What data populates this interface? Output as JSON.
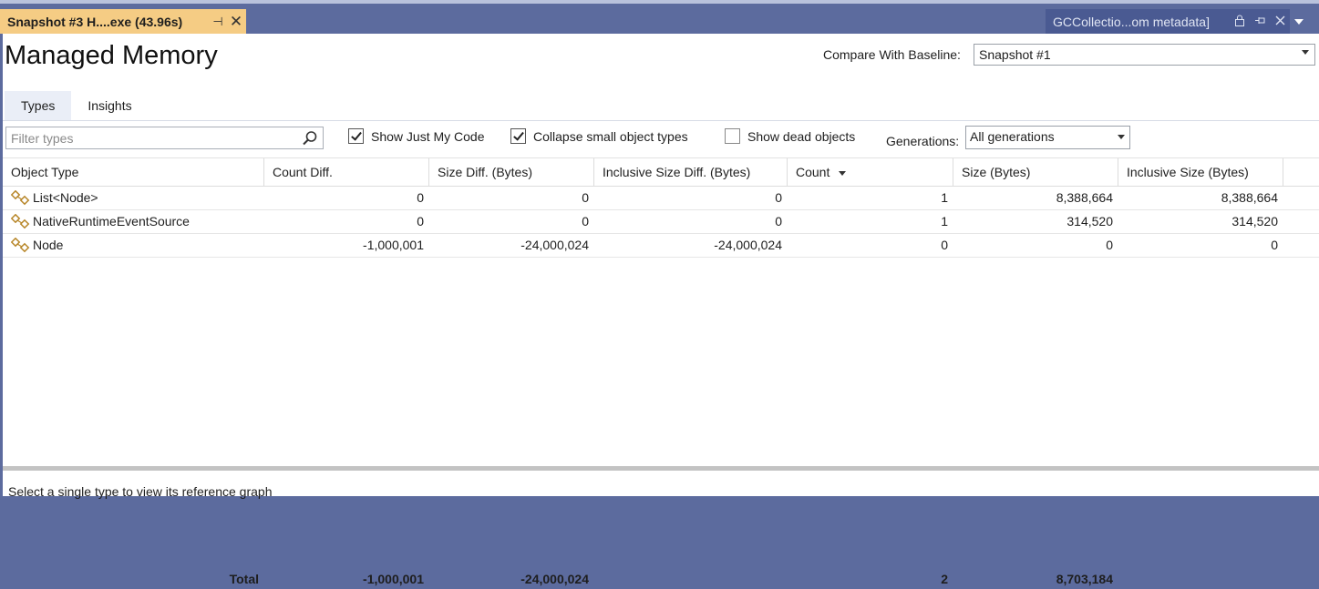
{
  "tabs": {
    "document_tab_title": "Snapshot #3 H....exe (43.96s)",
    "pin_glyph": "⊣",
    "close_glyph": "✕",
    "right_tab_title": "GCCollectio...om metadata]"
  },
  "page": {
    "title": "Managed Memory",
    "baseline_label": "Compare With Baseline:",
    "baseline_value": "Snapshot #1"
  },
  "view_tabs": [
    {
      "label": "Types",
      "active": true
    },
    {
      "label": "Insights",
      "active": false
    }
  ],
  "toolbar": {
    "filter_placeholder": "Filter types",
    "show_just_my_code": {
      "label": "Show Just My Code",
      "checked": true
    },
    "collapse_small": {
      "label": "Collapse small object types",
      "checked": true
    },
    "show_dead": {
      "label": "Show dead objects",
      "checked": false
    },
    "generations_label": "Generations:",
    "generations_value": "All generations"
  },
  "table": {
    "columns": [
      "Object Type",
      "Count Diff.",
      "Size Diff. (Bytes)",
      "Inclusive Size Diff. (Bytes)",
      "Count",
      "Size (Bytes)",
      "Inclusive Size (Bytes)"
    ],
    "sort_column": "Count",
    "rows": [
      {
        "type": "List<Node>",
        "count_diff": "0",
        "size_diff": "0",
        "incl_size_diff": "0",
        "count": "1",
        "size": "8,388,664",
        "incl_size": "8,388,664"
      },
      {
        "type": "NativeRuntimeEventSource",
        "count_diff": "0",
        "size_diff": "0",
        "incl_size_diff": "0",
        "count": "1",
        "size": "314,520",
        "incl_size": "314,520"
      },
      {
        "type": "Node",
        "count_diff": "-1,000,001",
        "size_diff": "-24,000,024",
        "incl_size_diff": "-24,000,024",
        "count": "0",
        "size": "0",
        "incl_size": "0"
      }
    ],
    "total": {
      "label": "Total",
      "count_diff": "-1,000,001",
      "size_diff": "-24,000,024",
      "count": "2",
      "size": "8,703,184"
    }
  },
  "status_text": "Select a single type to view its reference graph",
  "colors": {
    "chrome": "#5c6b9e",
    "active_tab": "#f5cc84",
    "type_icon": "#b8872a"
  }
}
